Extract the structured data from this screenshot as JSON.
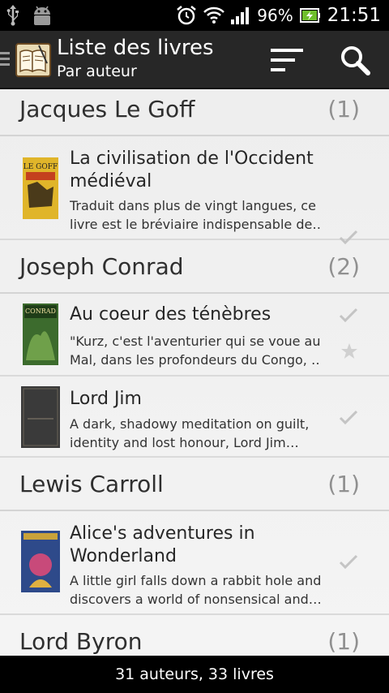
{
  "status": {
    "battery": "96%",
    "time": "21:51"
  },
  "header": {
    "title": "Liste des livres",
    "subtitle": "Par auteur"
  },
  "groups": [
    {
      "author": "Jacques Le Goff",
      "count": "(1)",
      "books": [
        {
          "title1": "La civilisation de l'Occident",
          "title2": "médiéval",
          "desc1": "Traduit dans plus de vingt langues, ce",
          "desc2": "livre est le bréviaire indispensable de…",
          "cover": {
            "brand": "LE GOFF",
            "bg": "#e0b52a"
          }
        }
      ]
    },
    {
      "author": "Joseph Conrad",
      "count": "(2)",
      "books": [
        {
          "title1": "Au coeur des ténèbres",
          "desc1": "\"Kurz, c'est l'aventurier qui se voue au",
          "desc2": "Mal, dans les profondeurs du Congo, …",
          "cover": {
            "brand": "CONRAD",
            "bg": "#3c6b2d"
          }
        },
        {
          "title1": "Lord Jim",
          "desc1": "A dark, shadowy meditation on guilt,",
          "desc2": "identity and lost honour, Lord Jim…",
          "cover": {
            "bg": "#3a3a3a"
          }
        }
      ]
    },
    {
      "author": "Lewis Carroll",
      "count": "(1)",
      "books": [
        {
          "title1": "Alice's adventures in",
          "title2": "Wonderland",
          "desc1": "A little girl falls down a rabbit hole and",
          "desc2": "discovers a world of nonsensical and…",
          "cover": {
            "bg": "#2e4a8a"
          }
        }
      ]
    },
    {
      "author": "Lord Byron",
      "count": "(1)"
    }
  ],
  "footer": {
    "summary": "31 auteurs, 33 livres"
  },
  "colors": {
    "actionbar": "#272727",
    "list_bg": "#eeeeee"
  }
}
